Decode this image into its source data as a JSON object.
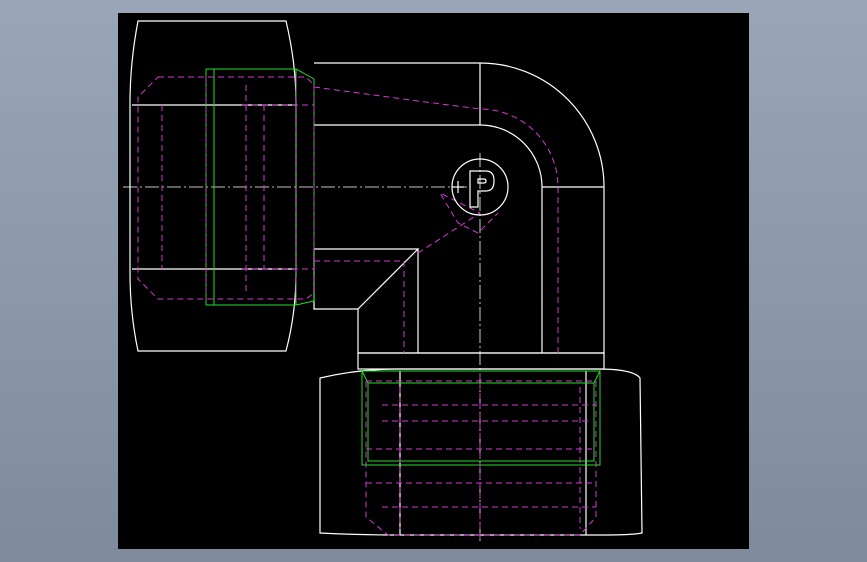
{
  "colors": {
    "background": "#000000",
    "outline": "#ffffff",
    "hidden_lines": "#d23ad2",
    "thread_lines": "#22dd22",
    "frame": "#8c98aa"
  },
  "logo": {
    "icon": "parker-p-logo-icon"
  }
}
